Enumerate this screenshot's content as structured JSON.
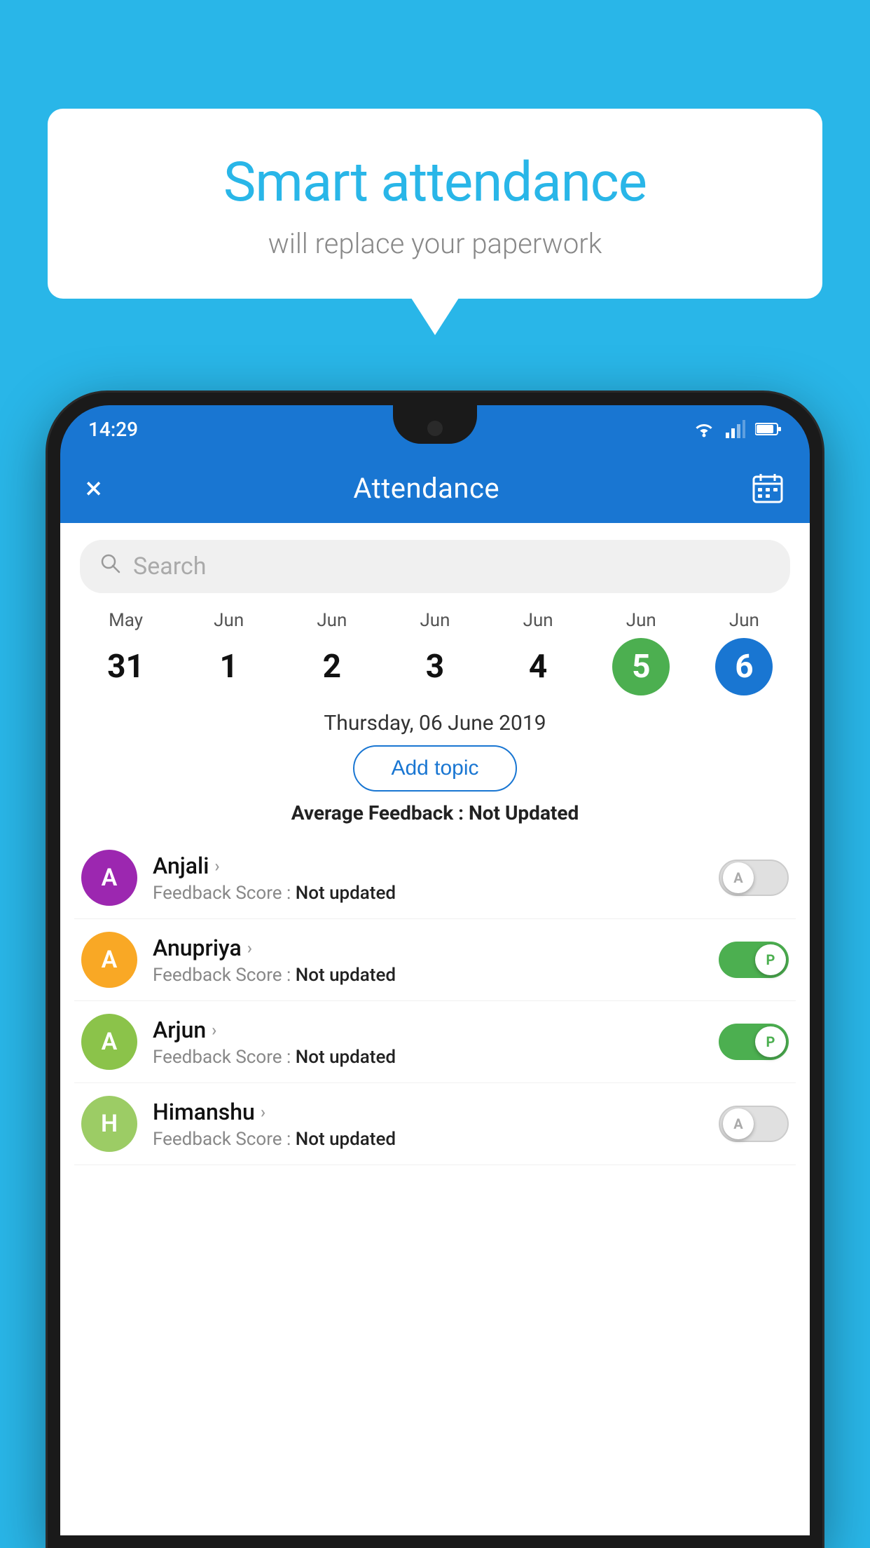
{
  "background_color": "#29b6e8",
  "bubble": {
    "title": "Smart attendance",
    "subtitle": "will replace your paperwork"
  },
  "status_bar": {
    "time": "14:29",
    "wifi_icon": "wifi-icon",
    "signal_icon": "signal-icon",
    "battery_icon": "battery-icon"
  },
  "app_bar": {
    "close_icon": "×",
    "title": "Attendance",
    "calendar_icon": "calendar-icon"
  },
  "search": {
    "placeholder": "Search"
  },
  "calendar": {
    "days": [
      {
        "month": "May",
        "date": "31",
        "state": "normal"
      },
      {
        "month": "Jun",
        "date": "1",
        "state": "normal"
      },
      {
        "month": "Jun",
        "date": "2",
        "state": "normal"
      },
      {
        "month": "Jun",
        "date": "3",
        "state": "normal"
      },
      {
        "month": "Jun",
        "date": "4",
        "state": "normal"
      },
      {
        "month": "Jun",
        "date": "5",
        "state": "today"
      },
      {
        "month": "Jun",
        "date": "6",
        "state": "selected"
      }
    ]
  },
  "selected_date": "Thursday, 06 June 2019",
  "add_topic_label": "Add topic",
  "avg_feedback_label": "Average Feedback :",
  "avg_feedback_value": "Not Updated",
  "students": [
    {
      "name": "Anjali",
      "initial": "A",
      "avatar_color": "#9c27b0",
      "feedback_label": "Feedback Score :",
      "feedback_value": "Not updated",
      "toggle_state": "off",
      "toggle_letter": "A"
    },
    {
      "name": "Anupriya",
      "initial": "A",
      "avatar_color": "#f9a825",
      "feedback_label": "Feedback Score :",
      "feedback_value": "Not updated",
      "toggle_state": "on",
      "toggle_letter": "P"
    },
    {
      "name": "Arjun",
      "initial": "A",
      "avatar_color": "#8bc34a",
      "feedback_label": "Feedback Score :",
      "feedback_value": "Not updated",
      "toggle_state": "on",
      "toggle_letter": "P"
    },
    {
      "name": "Himanshu",
      "initial": "H",
      "avatar_color": "#9ccc65",
      "feedback_label": "Feedback Score :",
      "feedback_value": "Not updated",
      "toggle_state": "off",
      "toggle_letter": "A"
    }
  ]
}
